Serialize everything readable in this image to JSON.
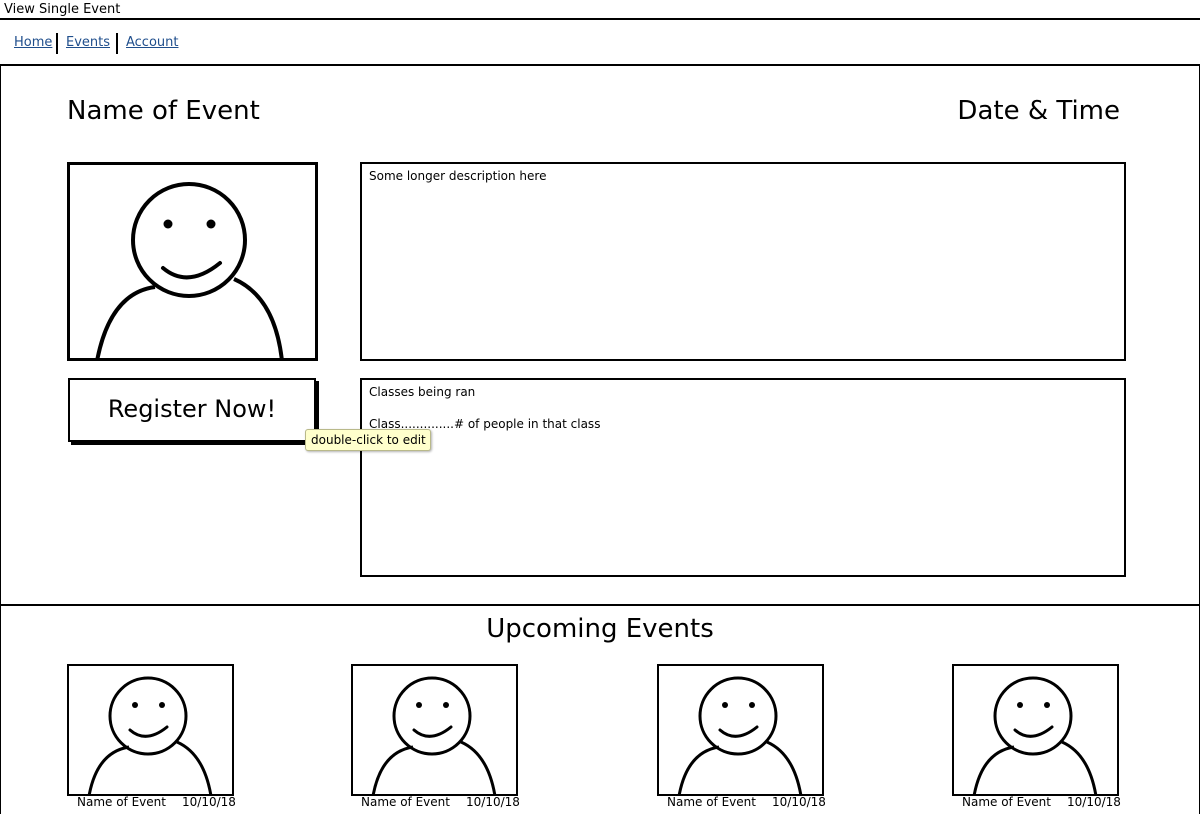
{
  "window": {
    "title": "View Single Event"
  },
  "nav": {
    "items": [
      {
        "label": "Home"
      },
      {
        "label": "Events"
      },
      {
        "label": "Account"
      }
    ]
  },
  "event": {
    "name": "Name of Event",
    "datetime": "Date & Time",
    "description": "Some longer description here",
    "classes_title": "Classes being ran",
    "classes_line": "Class..............# of people in that class",
    "image_icon": "person-placeholder-icon"
  },
  "register": {
    "label": "Register Now!"
  },
  "tooltip": {
    "text": "double-click to edit"
  },
  "upcoming": {
    "title": "Upcoming Events",
    "cards": [
      {
        "name": "Name of Event",
        "date": "10/10/18"
      },
      {
        "name": "Name of Event",
        "date": "10/10/18"
      },
      {
        "name": "Name of Event",
        "date": "10/10/18"
      },
      {
        "name": "Name of Event",
        "date": "10/10/18"
      }
    ]
  }
}
